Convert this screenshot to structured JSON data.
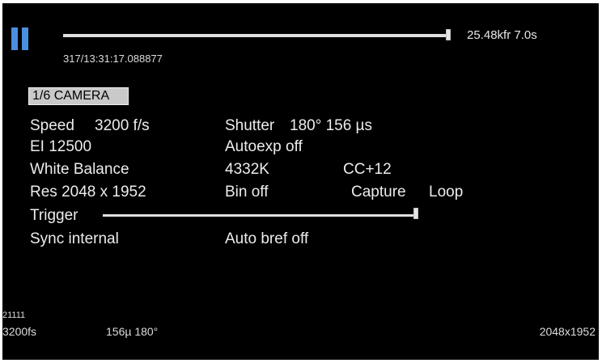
{
  "header": {
    "playback_rate": "25.48kfr 7.0s",
    "timestamp": "317/13:31:17.088877"
  },
  "menu": {
    "tab": "1/6 CAMERA"
  },
  "settings": {
    "speed_label": "Speed",
    "speed_value": "3200 f/s",
    "shutter_label": "Shutter",
    "shutter_value": "180°  156 µs",
    "ei": "EI  12500",
    "autoexp": "Autoexp  off",
    "white_balance_label": "White Balance",
    "white_balance_value": "4332K",
    "cc": "CC+12",
    "res": "Res  2048 x 1952",
    "bin": "Bin off",
    "capture_label": "Capture",
    "capture_value": "Loop",
    "trigger_label": "Trigger",
    "sync": "Sync internal",
    "auto_bref": "Auto bref  off"
  },
  "footer": {
    "counter": "21111",
    "fps": "3200fs",
    "shutter": "156µ  180°",
    "resolution": "2048x1952"
  },
  "colors": {
    "background": "#000000",
    "text": "#e6e6e6",
    "pause_icon": "#4a8fe0",
    "tab_bg": "#c9c9c9"
  }
}
